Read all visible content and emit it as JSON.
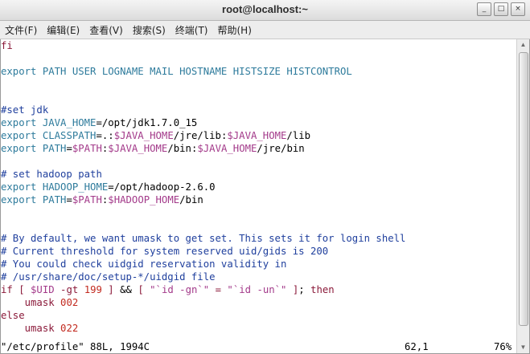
{
  "window": {
    "title": "root@localhost:~",
    "minimize_icon": "_",
    "maximize_icon": "□",
    "close_icon": "×"
  },
  "menu": [
    {
      "label": "文件(F)"
    },
    {
      "label": "编辑(E)"
    },
    {
      "label": "查看(V)"
    },
    {
      "label": "搜索(S)"
    },
    {
      "label": "终端(T)"
    },
    {
      "label": "帮助(H)"
    }
  ],
  "lines": [
    [
      {
        "t": "fi",
        "c": "kw"
      }
    ],
    [],
    [
      {
        "t": "export",
        "c": "id"
      },
      {
        "t": " PATH USER LOGNAME MAIL HOSTNAME HISTSIZE HISTCONTROL",
        "c": "id"
      }
    ],
    [],
    [],
    [
      {
        "t": "#set jdk",
        "c": "comment"
      }
    ],
    [
      {
        "t": "export",
        "c": "id"
      },
      {
        "t": " JAVA_HOME",
        "c": "id"
      },
      {
        "t": "=/opt/jdk1.7.0_15",
        "c": ""
      }
    ],
    [
      {
        "t": "export",
        "c": "id"
      },
      {
        "t": " CLASSPATH",
        "c": "id"
      },
      {
        "t": "=.:",
        "c": ""
      },
      {
        "t": "$JAVA_HOME",
        "c": "var"
      },
      {
        "t": "/jre/lib:",
        "c": ""
      },
      {
        "t": "$JAVA_HOME",
        "c": "var"
      },
      {
        "t": "/lib",
        "c": ""
      }
    ],
    [
      {
        "t": "export",
        "c": "id"
      },
      {
        "t": " PATH",
        "c": "id"
      },
      {
        "t": "=",
        "c": ""
      },
      {
        "t": "$PATH",
        "c": "var"
      },
      {
        "t": ":",
        "c": ""
      },
      {
        "t": "$JAVA_HOME",
        "c": "var"
      },
      {
        "t": "/bin:",
        "c": ""
      },
      {
        "t": "$JAVA_HOME",
        "c": "var"
      },
      {
        "t": "/jre/bin",
        "c": ""
      }
    ],
    [],
    [
      {
        "t": "# set hadoop path",
        "c": "comment"
      }
    ],
    [
      {
        "t": "export",
        "c": "id"
      },
      {
        "t": " HADOOP_HOME",
        "c": "id"
      },
      {
        "t": "=/opt/hadoop-2.6.0",
        "c": ""
      }
    ],
    [
      {
        "t": "export",
        "c": "id"
      },
      {
        "t": " PATH",
        "c": "id"
      },
      {
        "t": "=",
        "c": ""
      },
      {
        "t": "$PATH",
        "c": "var"
      },
      {
        "t": ":",
        "c": ""
      },
      {
        "t": "$HADOOP_HOME",
        "c": "var"
      },
      {
        "t": "/bin",
        "c": ""
      }
    ],
    [],
    [],
    [
      {
        "t": "# By default, we want umask to get set. This sets it for login shell",
        "c": "comment"
      }
    ],
    [
      {
        "t": "# Current threshold for system reserved uid/gids is 200",
        "c": "comment"
      }
    ],
    [
      {
        "t": "# You could check uidgid reservation validity in",
        "c": "comment"
      }
    ],
    [
      {
        "t": "# /usr/share/doc/setup-*/uidgid file",
        "c": "comment"
      }
    ],
    [
      {
        "t": "if",
        "c": "kw"
      },
      {
        "t": " [ ",
        "c": "kw"
      },
      {
        "t": "$UID",
        "c": "var"
      },
      {
        "t": " -gt ",
        "c": "kw"
      },
      {
        "t": "199",
        "c": "num"
      },
      {
        "t": " ] ",
        "c": "kw"
      },
      {
        "t": "&&",
        "c": ""
      },
      {
        "t": " [ ",
        "c": "kw"
      },
      {
        "t": "\"`id -gn`\"",
        "c": "str"
      },
      {
        "t": " = ",
        "c": "kw"
      },
      {
        "t": "\"`id -un`\"",
        "c": "str"
      },
      {
        "t": " ]",
        "c": "kw"
      },
      {
        "t": "; ",
        "c": ""
      },
      {
        "t": "then",
        "c": "kw"
      }
    ],
    [
      {
        "t": "    umask ",
        "c": "kw"
      },
      {
        "t": "002",
        "c": "num"
      }
    ],
    [
      {
        "t": "else",
        "c": "kw"
      }
    ],
    [
      {
        "t": "    umask ",
        "c": "kw"
      },
      {
        "t": "022",
        "c": "num"
      }
    ]
  ],
  "status": {
    "file": "\"/etc/profile\" 88L, 1994C",
    "position": "62,1",
    "percent": "76%"
  },
  "scroll": {
    "up_icon": "▲",
    "down_icon": "▼"
  }
}
